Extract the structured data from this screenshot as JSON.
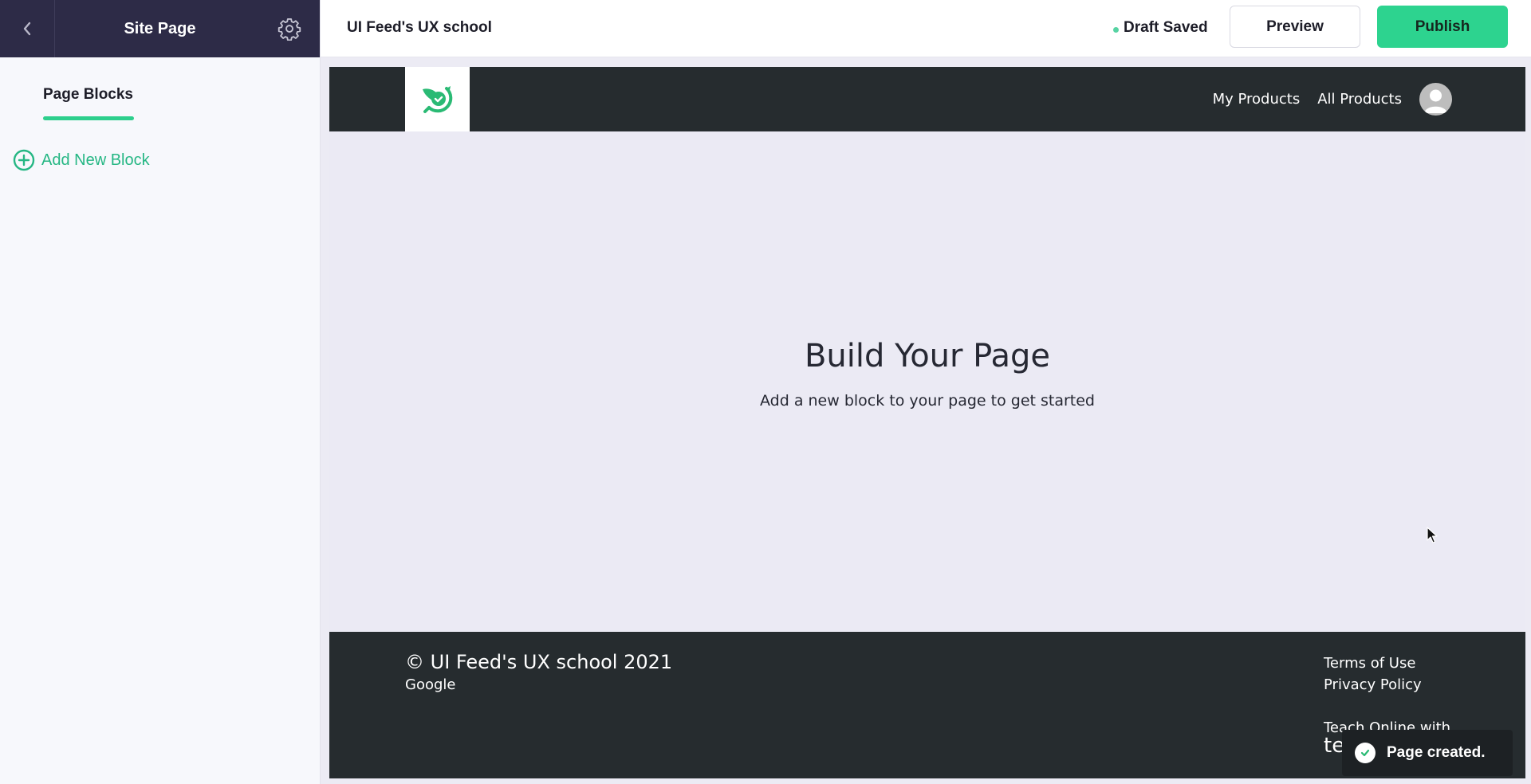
{
  "sidebar": {
    "title": "Site Page",
    "tab_label": "Page Blocks",
    "add_block_label": "Add New Block",
    "icons": {
      "back": "chevron-left-icon",
      "settings": "gear-icon",
      "add": "plus-circle-icon"
    }
  },
  "topbar": {
    "site_title": "UI Feed's UX school",
    "status": "Draft Saved",
    "preview_label": "Preview",
    "publish_label": "Publish"
  },
  "site_header": {
    "nav": [
      "My Products",
      "All Products"
    ],
    "logo": "bird-check-logo",
    "avatar": "user-avatar-icon"
  },
  "empty_state": {
    "title": "Build Your Page",
    "subtitle": "Add a new block to your page to get started"
  },
  "site_footer": {
    "copyright": "© UI Feed's UX school 2021",
    "sub": "Google",
    "links": [
      "Terms of Use",
      "Privacy Policy"
    ],
    "teach": "Teach Online with",
    "brand_partial": "te"
  },
  "toast": {
    "message": "Page created.",
    "icon": "check-circle-icon"
  },
  "colors": {
    "accent": "#2dd38f",
    "sidebar_header": "#2d2b47",
    "site_dark": "#262c2f",
    "canvas_bg": "#ebeaf4"
  }
}
